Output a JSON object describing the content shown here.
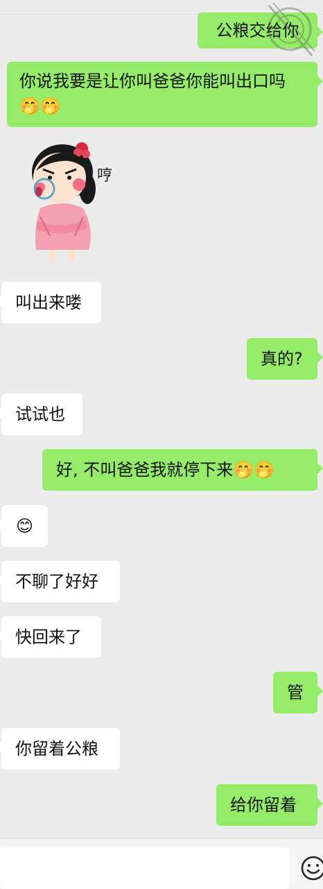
{
  "messages": [
    {
      "from": "me",
      "text": "公粮交给你"
    },
    {
      "from": "me",
      "text": "你说我要是让你叫爸爸你能叫出口吗🤭🤭"
    },
    {
      "from": "them",
      "type": "sticker",
      "sticker_text": "哼"
    },
    {
      "from": "them",
      "text": "叫出来喽"
    },
    {
      "from": "me",
      "text": "真的?"
    },
    {
      "from": "them",
      "text": "试试也"
    },
    {
      "from": "me",
      "text": "好, 不叫爸爸我就停下来🤭🤭"
    },
    {
      "from": "them",
      "text": "😊"
    },
    {
      "from": "them",
      "text": "不聊了好好"
    },
    {
      "from": "them",
      "text": "快回来了"
    },
    {
      "from": "me",
      "text": "管"
    },
    {
      "from": "them",
      "text": "你留着公粮"
    },
    {
      "from": "me",
      "text": "给你留着"
    }
  ],
  "input": {
    "placeholder": ""
  },
  "colors": {
    "background": "#ececec",
    "my_bubble": "#95ec69",
    "their_bubble": "#ffffff"
  }
}
